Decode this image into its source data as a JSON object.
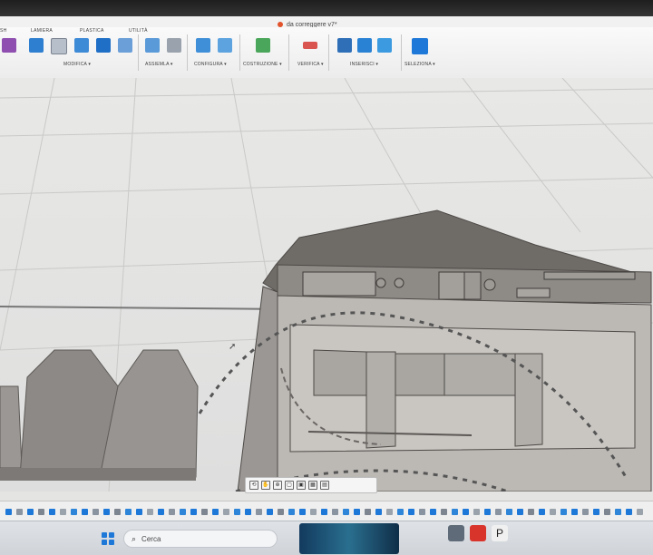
{
  "app": {
    "document_title": "da correggere v7*"
  },
  "ribbon": {
    "tabs": [
      "SH",
      "LAMIERA",
      "PLASTICA",
      "UTILITÀ"
    ],
    "groups": [
      "MODIFICA ▾",
      "ASSIEMLA ▾",
      "CONFIGURA ▾",
      "COSTRUZIONE ▾",
      "VERIFICA ▾",
      "INSERISCI ▾",
      "SELEZIONA ▾"
    ]
  },
  "taskbar": {
    "search_label": "Cerca"
  },
  "colors": {
    "accent": "#1e78d8",
    "model_body": "#8f8c88",
    "model_top": "#6f6b67"
  },
  "icons": [
    "search-icon",
    "windows-start-icon",
    "pan-icon",
    "zoom-icon",
    "orbit-icon",
    "display-settings-icon",
    "cursor-icon"
  ]
}
